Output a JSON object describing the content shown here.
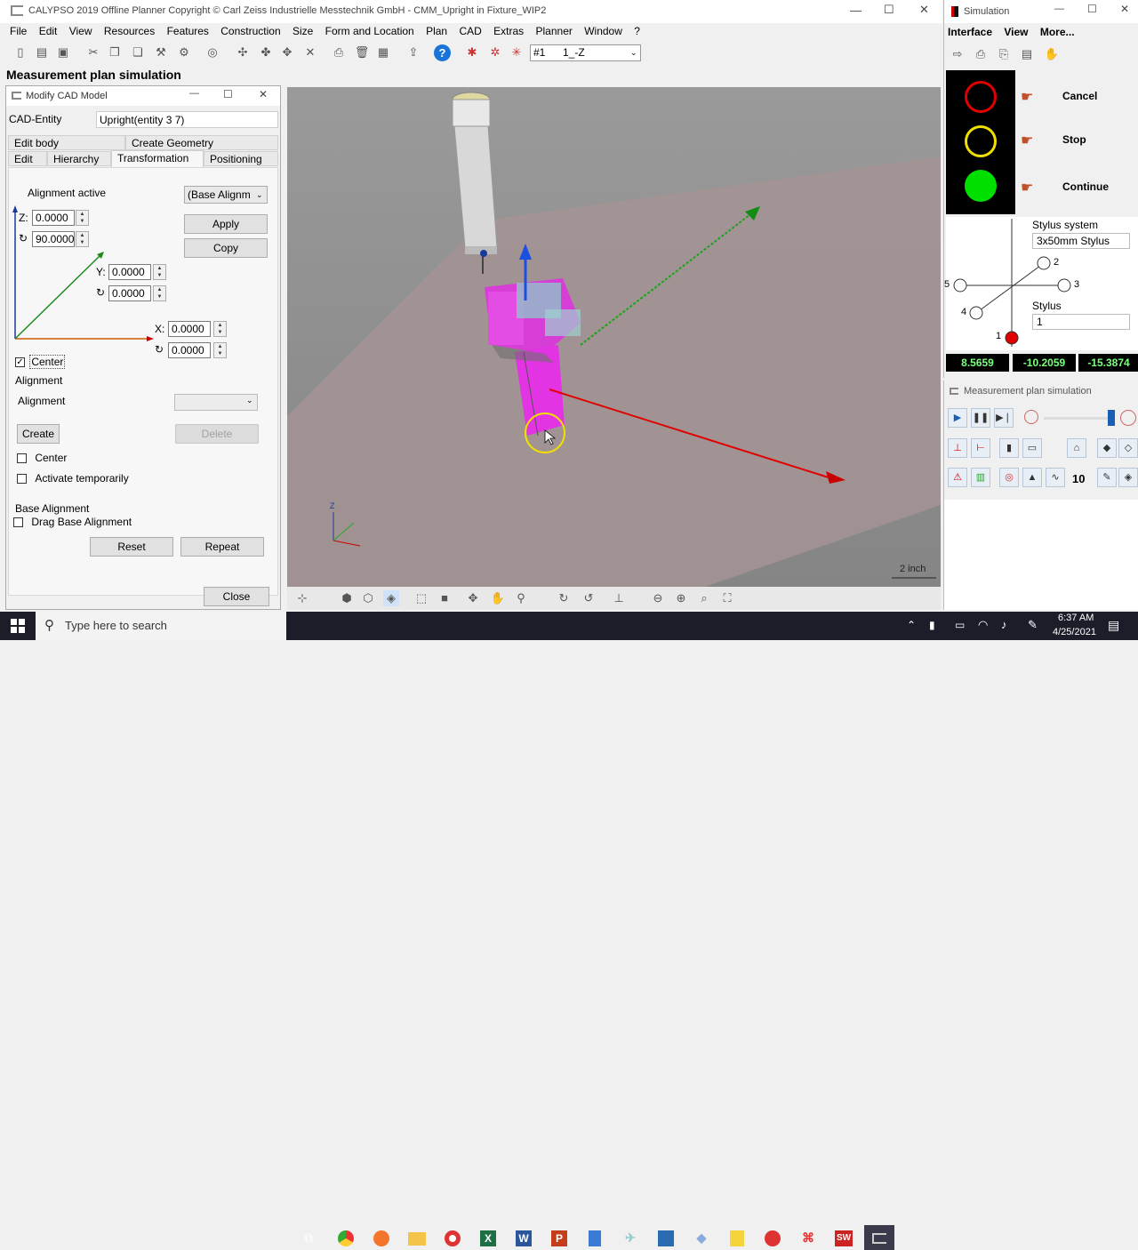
{
  "main_window": {
    "title": "CALYPSO 2019 Offline Planner Copyright © Carl Zeiss Industrielle Messtechnik GmbH - CMM_Upright in Fixture_WIP2",
    "menu": [
      "File",
      "Edit",
      "View",
      "Resources",
      "Features",
      "Construction",
      "Size",
      "Form and Location",
      "Plan",
      "CAD",
      "Extras",
      "Planner",
      "Window",
      "?"
    ],
    "toolbar_select_prefix": "#1",
    "toolbar_select_value": "1_-Z",
    "panel_title": "Measurement plan simulation"
  },
  "modify_cad": {
    "title": "Modify CAD Model",
    "entity_label": "CAD-Entity",
    "entity_value": "Upright(entity 3 7)",
    "tabs_row1": [
      "Edit body",
      "Create Geometry"
    ],
    "tabs_row2": [
      "Edit",
      "Hierarchy",
      "Transformation",
      "Positioning"
    ],
    "alignment_active": "Alignment active",
    "base_alignment_select": "(Base Alignm",
    "apply": "Apply",
    "copy": "Copy",
    "z_label": "Z:",
    "z_value": "0.0000",
    "rot_z_value": "90.0000",
    "y_label": "Y:",
    "y_value": "0.0000",
    "rot_y_value": "0.0000",
    "x_label": "X:",
    "x_value": "0.0000",
    "rot_x_value": "0.0000",
    "center_label": "Center",
    "alignment_section": "Alignment",
    "alignment_label": "Alignment",
    "create": "Create",
    "delete": "Delete",
    "center2": "Center",
    "activate_temp": "Activate temporarily",
    "base_alignment_section": "Base Alignment",
    "drag_base": "Drag Base Alignment",
    "reset": "Reset",
    "repeat": "Repeat",
    "close": "Close"
  },
  "viewport": {
    "scale_label": "2 inch",
    "axis_z": "Z"
  },
  "simulation": {
    "title": "Simulation",
    "menu": [
      "Interface",
      "View",
      "More..."
    ],
    "cancel": "Cancel",
    "stop": "Stop",
    "continue": "Continue",
    "stylus_system_label": "Stylus system",
    "stylus_system_value": "3x50mm Stylus",
    "stylus_label": "Stylus",
    "stylus_value": "1",
    "stylus_numbers": [
      "1",
      "2",
      "3",
      "4",
      "5"
    ],
    "coord_x": "8.5659",
    "coord_y": "-10.2059",
    "coord_z": "-15.3874",
    "colors": {
      "red": "#e00000",
      "yellow": "#f0e000",
      "green": "#00e000"
    }
  },
  "mps": {
    "title": "Measurement plan simulation",
    "count": "10"
  },
  "taskbar": {
    "search_placeholder": "Type here to search",
    "time": "6:37 AM",
    "date": "4/25/2021"
  }
}
